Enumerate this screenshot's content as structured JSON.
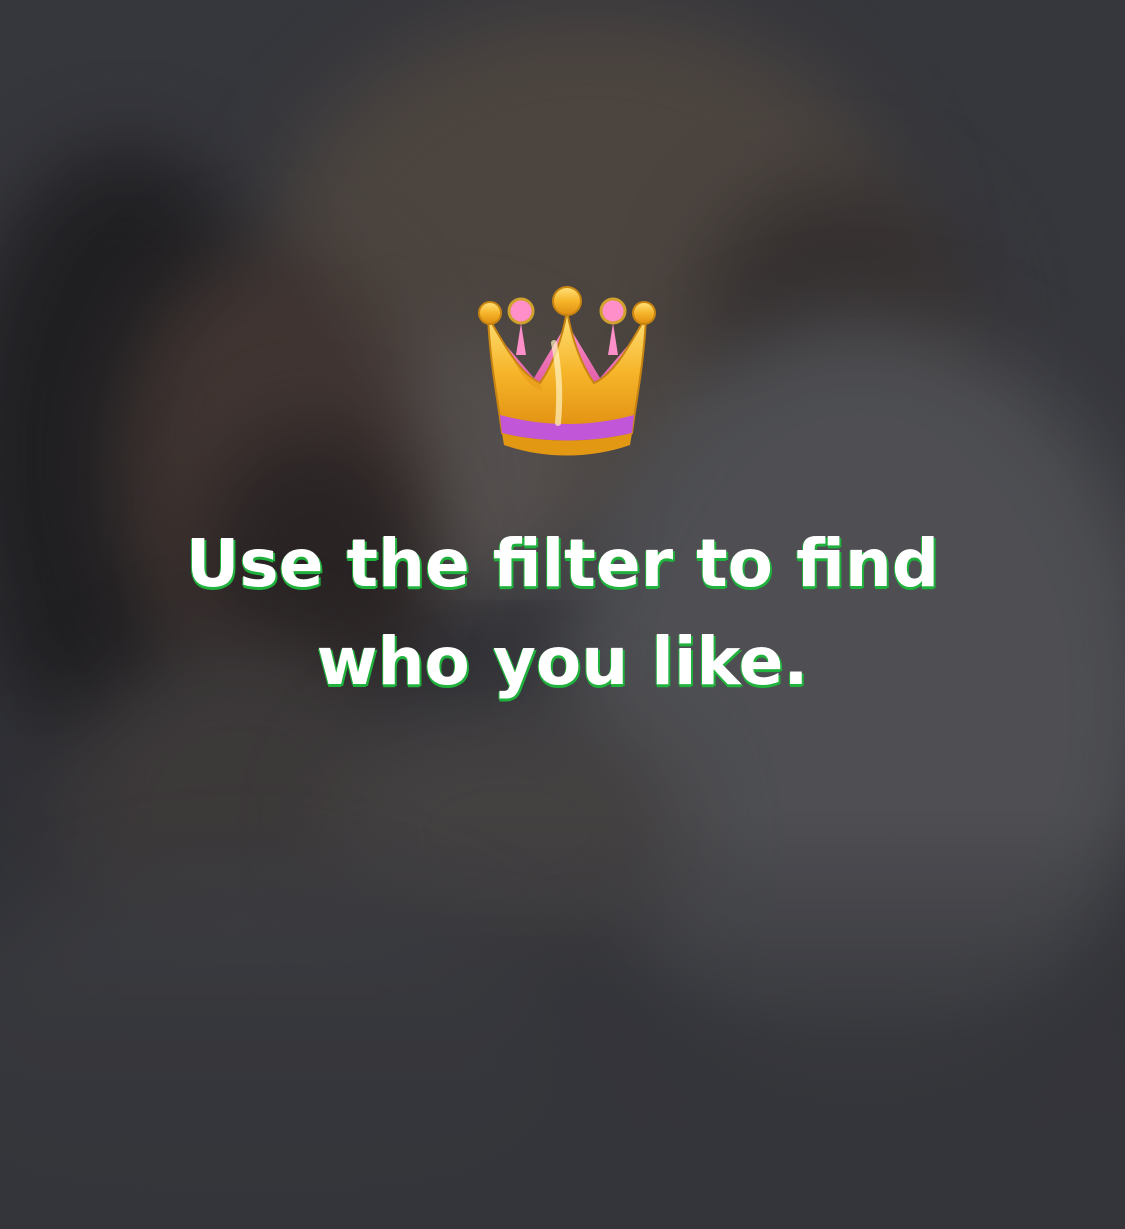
{
  "promo": {
    "icon": "crown-icon",
    "headline": {
      "line1": "Use the filter to find",
      "line2": "who you like."
    }
  },
  "colors": {
    "background": "#34353a",
    "text": "#ffffff",
    "text_outline": "#1fb23c",
    "crown_gold": "#f2b01e",
    "crown_band": "#c157d8"
  }
}
